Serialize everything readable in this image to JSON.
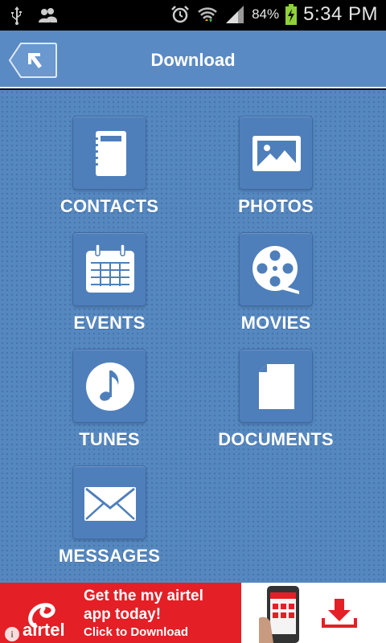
{
  "status_bar": {
    "battery_percent": "84%",
    "time": "5:34 PM",
    "icons": [
      "usb-icon",
      "people-icon",
      "alarm-icon",
      "wifi-icon",
      "signal-icon",
      "battery-charging-icon"
    ]
  },
  "header": {
    "title": "Download",
    "back_icon": "back-arrow-icon"
  },
  "grid": {
    "contacts_label": "CONTACTS",
    "photos_label": "PHOTOS",
    "events_label": "EVENTS",
    "movies_label": "MOVIES",
    "tunes_label": "TUNES",
    "documents_label": "DOCUMENTS",
    "messages_label": "MESSAGES"
  },
  "ad": {
    "brand": "airtel",
    "line1": "Get the my airtel",
    "line2": "app today!",
    "line3": "Click to Download",
    "info": "i"
  },
  "colors": {
    "background": "#5688c0",
    "tile": "#4f7fba",
    "ad_red": "#e41f26"
  }
}
